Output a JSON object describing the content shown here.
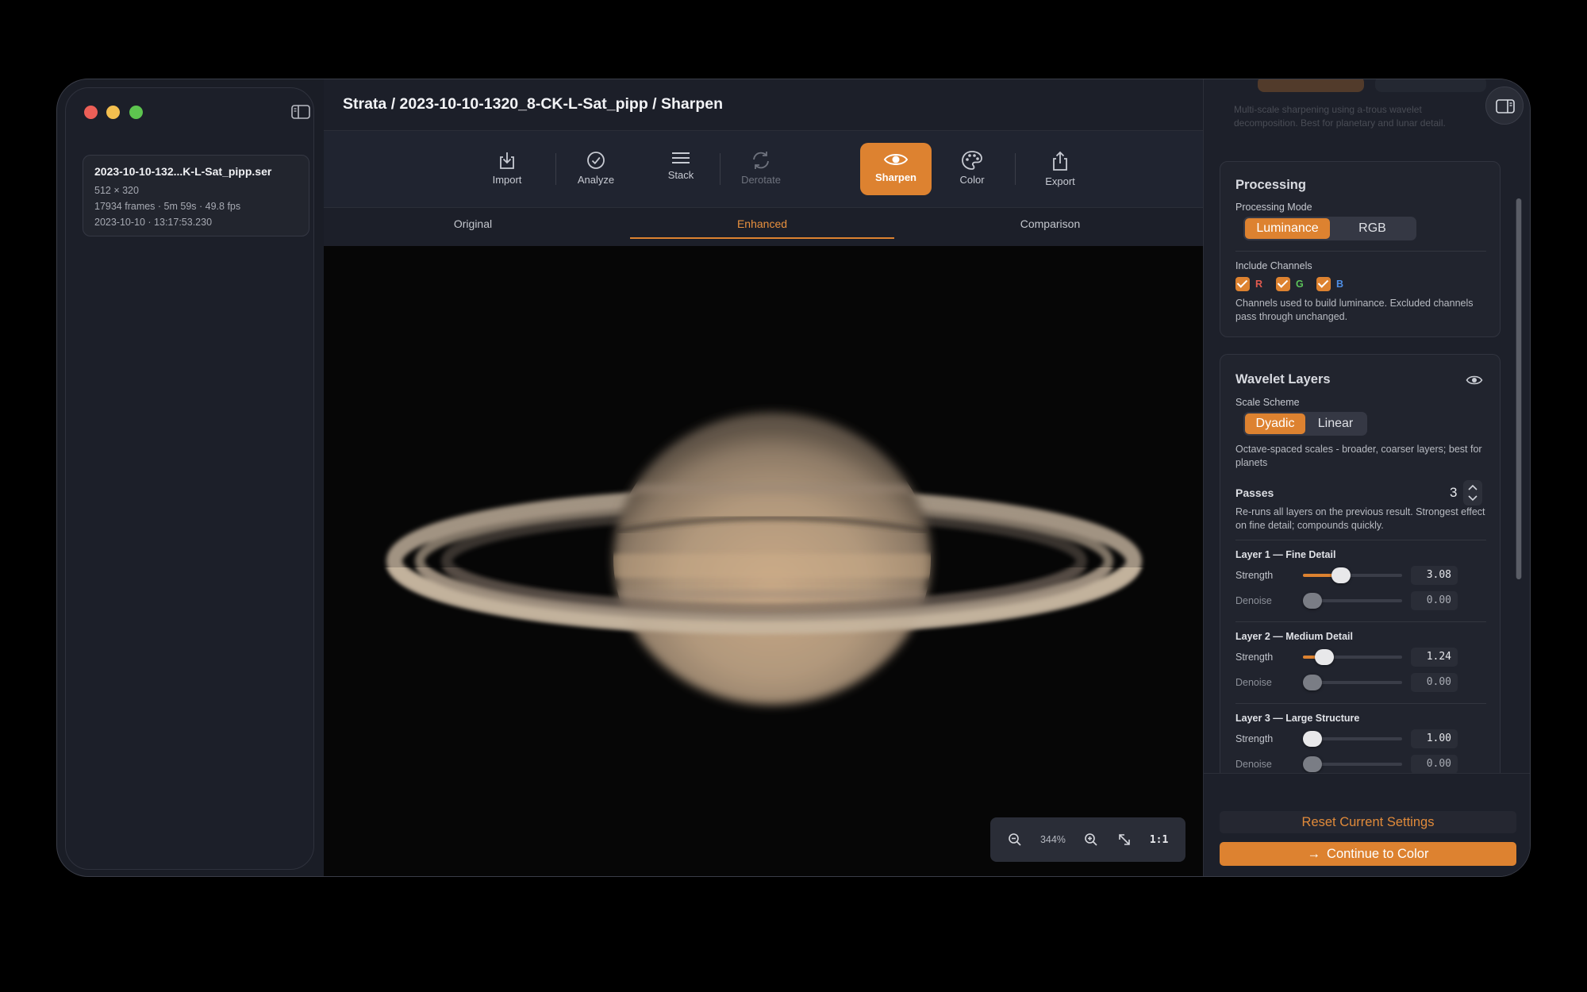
{
  "breadcrumb": "Strata / 2023-10-10-1320_8-CK-L-Sat_pipp / Sharpen",
  "file": {
    "name": "2023-10-10-132...K-L-Sat_pipp.ser",
    "dimensions": "512 × 320",
    "frames": "17934 frames · 5m 59s · 49.8 fps",
    "timestamp": "2023-10-10 · 13:17:53.230"
  },
  "toolbar": {
    "import": "Import",
    "analyze": "Analyze",
    "stack": "Stack",
    "derotate": "Derotate",
    "sharpen": "Sharpen",
    "color": "Color",
    "export": "Export"
  },
  "view_tabs": {
    "original": "Original",
    "enhanced": "Enhanced",
    "comparison": "Comparison"
  },
  "zoom": {
    "level": "344%",
    "one_to_one": "1:1"
  },
  "panel": {
    "top_description": "Multi-scale sharpening using a-trous wavelet decomposition. Best for planetary and lunar detail.",
    "processing": {
      "title": "Processing",
      "mode_label": "Processing Mode",
      "mode_options": [
        "Luminance",
        "RGB"
      ],
      "mode_selected": "Luminance",
      "channels_label": "Include Channels",
      "channel_r": "R",
      "channel_g": "G",
      "channel_b": "B",
      "channels_help": "Channels used to build luminance. Excluded channels pass through unchanged."
    },
    "wavelet": {
      "title": "Wavelet Layers",
      "scheme_label": "Scale Scheme",
      "scheme_options": [
        "Dyadic",
        "Linear"
      ],
      "scheme_selected": "Dyadic",
      "scheme_help": "Octave-spaced scales - broader, coarser layers; best for planets",
      "passes_label": "Passes",
      "passes_value": "3",
      "passes_help": "Re-runs all layers on the previous result. Strongest effect on fine detail; compounds quickly.",
      "strength_label": "Strength",
      "denoise_label": "Denoise",
      "layers": [
        {
          "title": "Layer 1 — Fine Detail",
          "strength": "3.08",
          "denoise": "0.00",
          "strength_fraction": 0.36,
          "denoise_fraction": 0.0
        },
        {
          "title": "Layer 2 — Medium Detail",
          "strength": "1.24",
          "denoise": "0.00",
          "strength_fraction": 0.15,
          "denoise_fraction": 0.0
        },
        {
          "title": "Layer 3 — Large Structure",
          "strength": "1.00",
          "denoise": "0.00",
          "strength_fraction": 0.0,
          "denoise_fraction": 0.0
        }
      ]
    },
    "reset_label": "Reset Current Settings",
    "continue_label": "Continue to Color",
    "continue_arrow": "→"
  },
  "colors": {
    "accent": "#dd8230",
    "channel_r": "#e25a4f",
    "channel_g": "#5cc45a",
    "channel_b": "#4f8fe6"
  },
  "icons": [
    "sidebar-toggle-icon",
    "import-icon",
    "analyze-icon",
    "stack-icon",
    "derotate-icon",
    "sharpen-eye-icon",
    "color-palette-icon",
    "export-icon",
    "zoom-out-icon",
    "zoom-in-icon",
    "fit-expand-icon",
    "inspector-toggle-icon",
    "visibility-eye-icon",
    "stepper-icon"
  ]
}
